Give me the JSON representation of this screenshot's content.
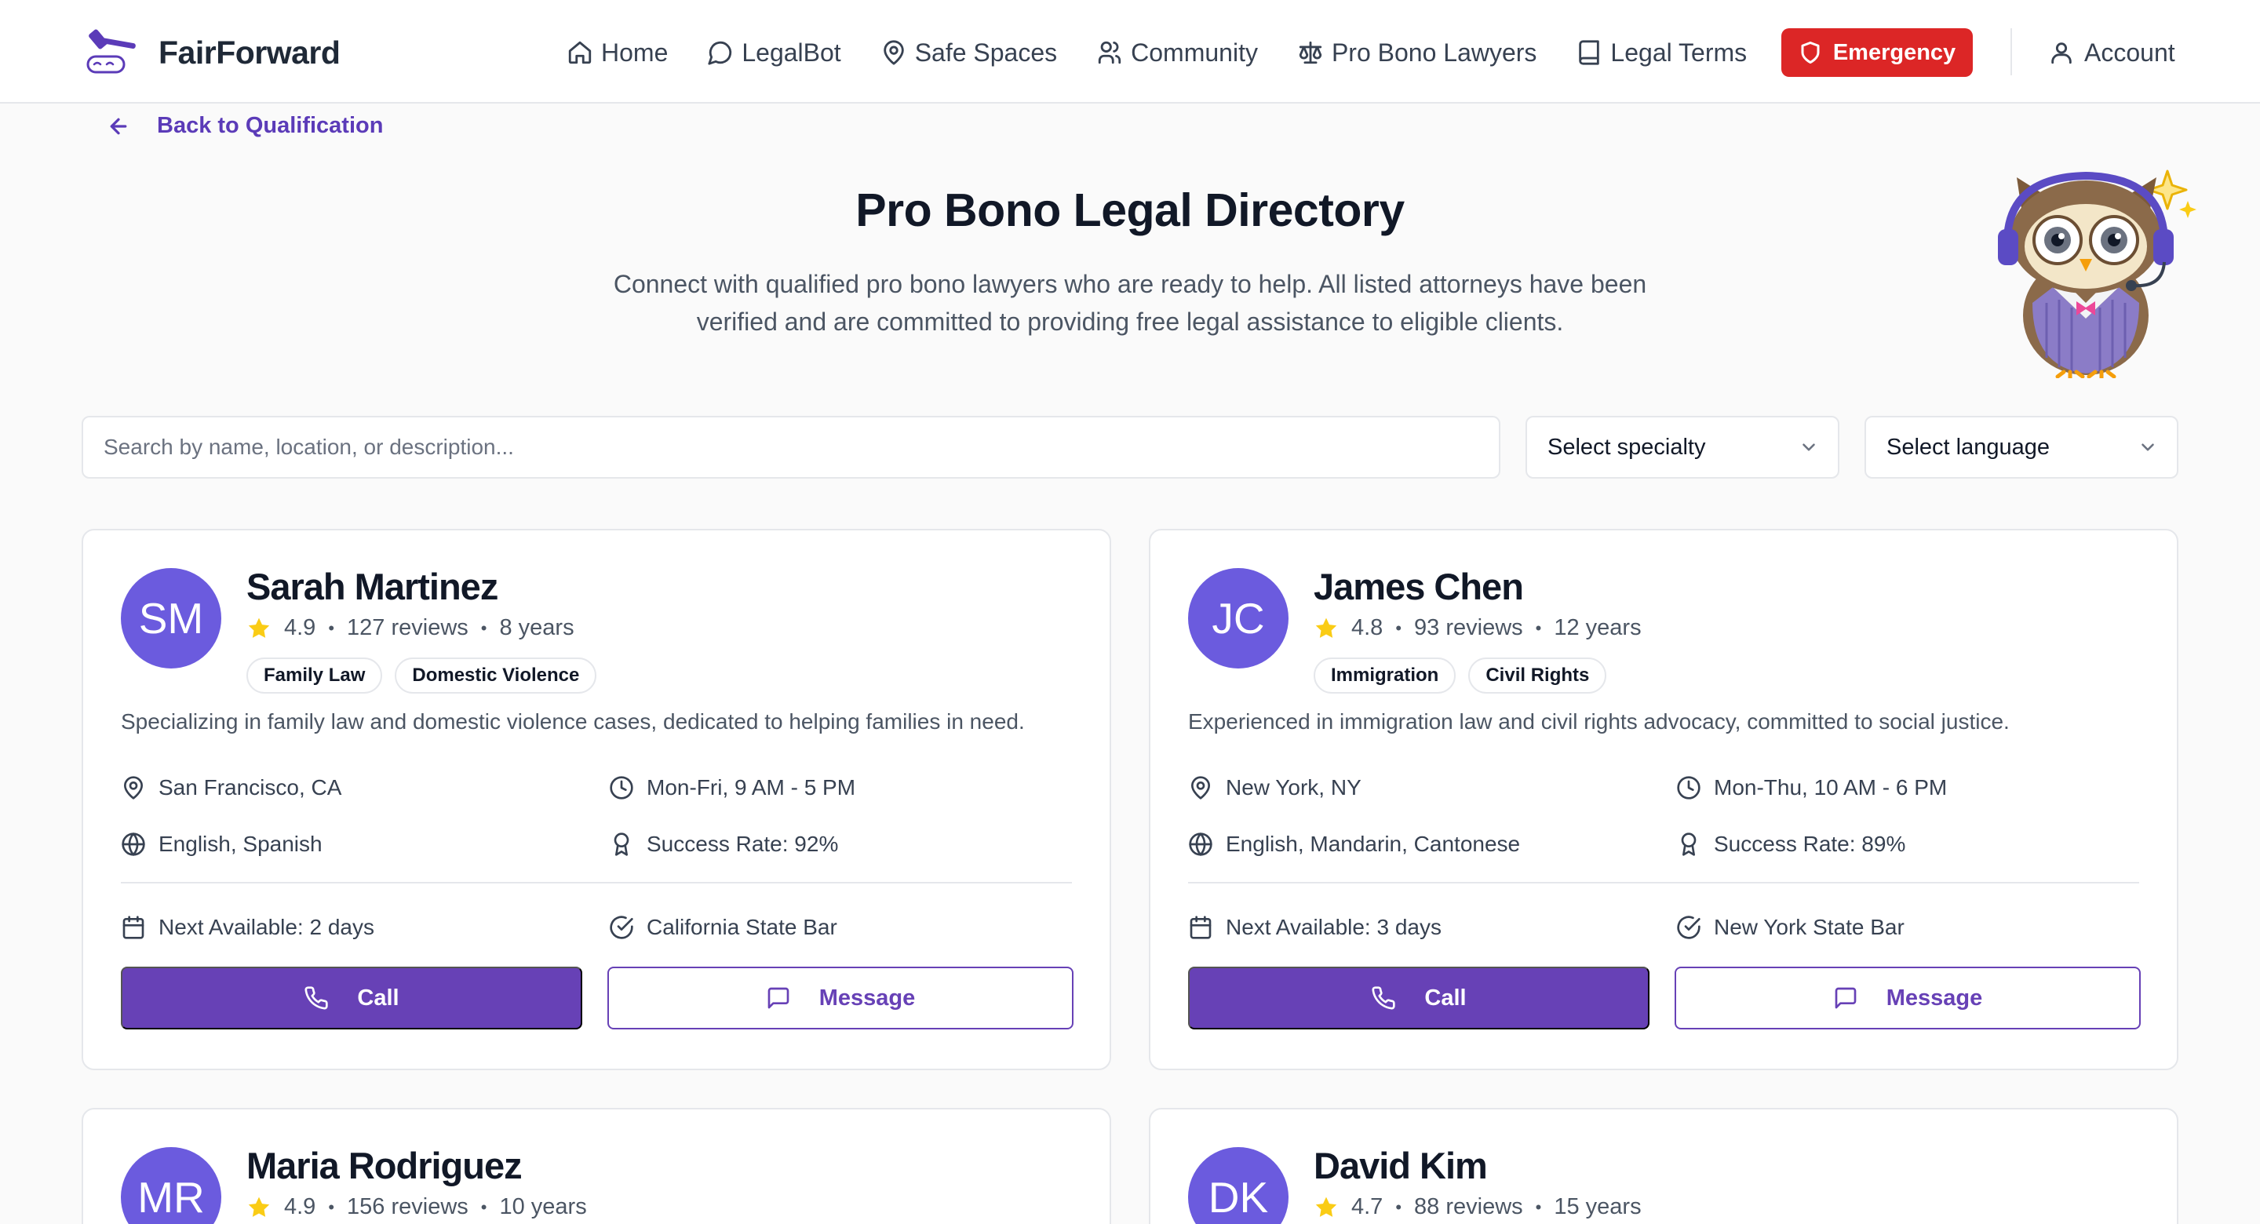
{
  "brand": {
    "name": "FairForward"
  },
  "nav": {
    "items": [
      {
        "label": "Home",
        "icon": "home-icon"
      },
      {
        "label": "LegalBot",
        "icon": "chat-bubble-icon"
      },
      {
        "label": "Safe Spaces",
        "icon": "map-pin-icon"
      },
      {
        "label": "Community",
        "icon": "users-icon"
      },
      {
        "label": "Pro Bono Lawyers",
        "icon": "scale-icon"
      },
      {
        "label": "Legal Terms",
        "icon": "book-icon"
      }
    ],
    "emergency": "Emergency",
    "account": "Account"
  },
  "back_link": "Back to Qualification",
  "page": {
    "title": "Pro Bono Legal Directory",
    "subtitle": "Connect with qualified pro bono lawyers who are ready to help. All listed attorneys have been verified and are committed to providing free legal assistance to eligible clients."
  },
  "filters": {
    "search_placeholder": "Search by name, location, or description...",
    "specialty": "Select specialty",
    "language": "Select language"
  },
  "colors": {
    "accent": "#6741b6",
    "emergency": "#dc2626",
    "avatar": "#6b5bde",
    "star": "#facc15"
  },
  "lawyers": [
    {
      "initials": "SM",
      "name": "Sarah Martinez",
      "rating": "4.9",
      "reviews": "127 reviews",
      "years": "8 years",
      "tags": [
        "Family Law",
        "Domestic Violence"
      ],
      "description": "Specializing in family law and domestic violence cases, dedicated to helping families in need.",
      "location": "San Francisco, CA",
      "hours": "Mon-Fri, 9 AM - 5 PM",
      "languages": "English, Spanish",
      "success": "Success Rate: 92%",
      "next_available": "Next Available: 2 days",
      "bar": "California State Bar",
      "call": "Call",
      "message": "Message"
    },
    {
      "initials": "JC",
      "name": "James Chen",
      "rating": "4.8",
      "reviews": "93 reviews",
      "years": "12 years",
      "tags": [
        "Immigration",
        "Civil Rights"
      ],
      "description": "Experienced in immigration law and civil rights advocacy, committed to social justice.",
      "location": "New York, NY",
      "hours": "Mon-Thu, 10 AM - 6 PM",
      "languages": "English, Mandarin, Cantonese",
      "success": "Success Rate: 89%",
      "next_available": "Next Available: 3 days",
      "bar": "New York State Bar",
      "call": "Call",
      "message": "Message"
    },
    {
      "initials": "MR",
      "name": "Maria Rodriguez",
      "rating": "4.9",
      "reviews": "156 reviews",
      "years": "10 years"
    },
    {
      "initials": "DK",
      "name": "David Kim",
      "rating": "4.7",
      "reviews": "88 reviews",
      "years": "15 years"
    }
  ]
}
